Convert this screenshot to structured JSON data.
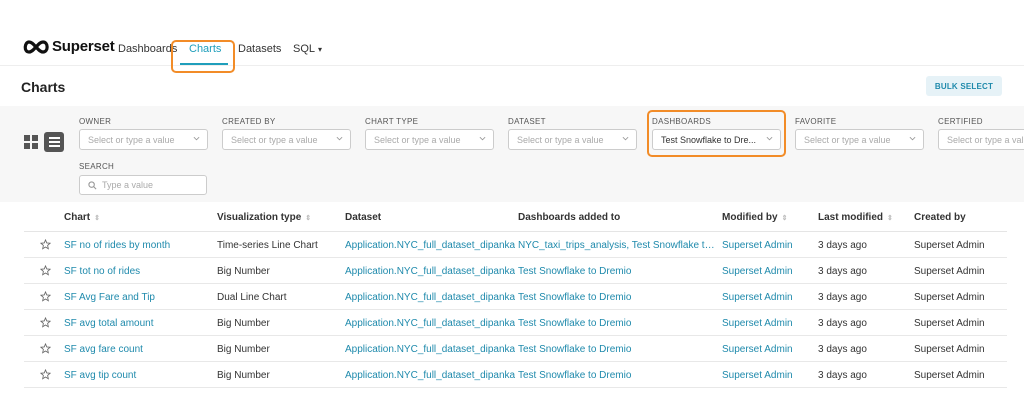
{
  "brand": {
    "name": "Superset"
  },
  "nav": {
    "dashboards": "Dashboards",
    "charts": "Charts",
    "datasets": "Datasets",
    "sql": "SQL"
  },
  "page": {
    "title": "Charts",
    "bulk_select": "BULK SELECT"
  },
  "filters": {
    "owner": {
      "label": "OWNER",
      "placeholder": "Select or type a value"
    },
    "created_by": {
      "label": "CREATED BY",
      "placeholder": "Select or type a value"
    },
    "chart_type": {
      "label": "CHART TYPE",
      "placeholder": "Select or type a value"
    },
    "dataset": {
      "label": "DATASET",
      "placeholder": "Select or type a value"
    },
    "dashboards": {
      "label": "DASHBOARDS",
      "value": "Test Snowflake to Dre..."
    },
    "favorite": {
      "label": "FAVORITE",
      "placeholder": "Select or type a value"
    },
    "certified": {
      "label": "CERTIFIED",
      "placeholder": "Select or type a value"
    },
    "search": {
      "label": "SEARCH",
      "placeholder": "Type a value"
    }
  },
  "table": {
    "columns": {
      "chart": "Chart",
      "viz_type": "Visualization type",
      "dataset": "Dataset",
      "dashboards": "Dashboards added to",
      "modified_by": "Modified by",
      "last_modified": "Last modified",
      "created_by": "Created by"
    },
    "rows": [
      {
        "chart": "SF no of rides by month",
        "viz_type": "Time-series Line Chart",
        "dataset": "Application.NYC_full_dataset_dipankar",
        "dashboards": "NYC_taxi_trips_analysis, Test Snowflake to Dremio",
        "modified_by": "Superset Admin",
        "last_modified": "3 days ago",
        "created_by": "Superset Admin"
      },
      {
        "chart": "SF tot no of rides",
        "viz_type": "Big Number",
        "dataset": "Application.NYC_full_dataset_dipankar",
        "dashboards": "Test Snowflake to Dremio",
        "modified_by": "Superset Admin",
        "last_modified": "3 days ago",
        "created_by": "Superset Admin"
      },
      {
        "chart": "SF Avg Fare and Tip",
        "viz_type": "Dual Line Chart",
        "dataset": "Application.NYC_full_dataset_dipankar",
        "dashboards": "Test Snowflake to Dremio",
        "modified_by": "Superset Admin",
        "last_modified": "3 days ago",
        "created_by": "Superset Admin"
      },
      {
        "chart": "SF avg total amount",
        "viz_type": "Big Number",
        "dataset": "Application.NYC_full_dataset_dipankar",
        "dashboards": "Test Snowflake to Dremio",
        "modified_by": "Superset Admin",
        "last_modified": "3 days ago",
        "created_by": "Superset Admin"
      },
      {
        "chart": "SF avg fare count",
        "viz_type": "Big Number",
        "dataset": "Application.NYC_full_dataset_dipankar",
        "dashboards": "Test Snowflake to Dremio",
        "modified_by": "Superset Admin",
        "last_modified": "3 days ago",
        "created_by": "Superset Admin"
      },
      {
        "chart": "SF avg tip count",
        "viz_type": "Big Number",
        "dataset": "Application.NYC_full_dataset_dipankar",
        "dashboards": "Test Snowflake to Dremio",
        "modified_by": "Superset Admin",
        "last_modified": "3 days ago",
        "created_by": "Superset Admin"
      }
    ]
  },
  "colors": {
    "accent": "#1f9ebb",
    "highlight": "#f28c28",
    "link": "#1f8aac"
  }
}
